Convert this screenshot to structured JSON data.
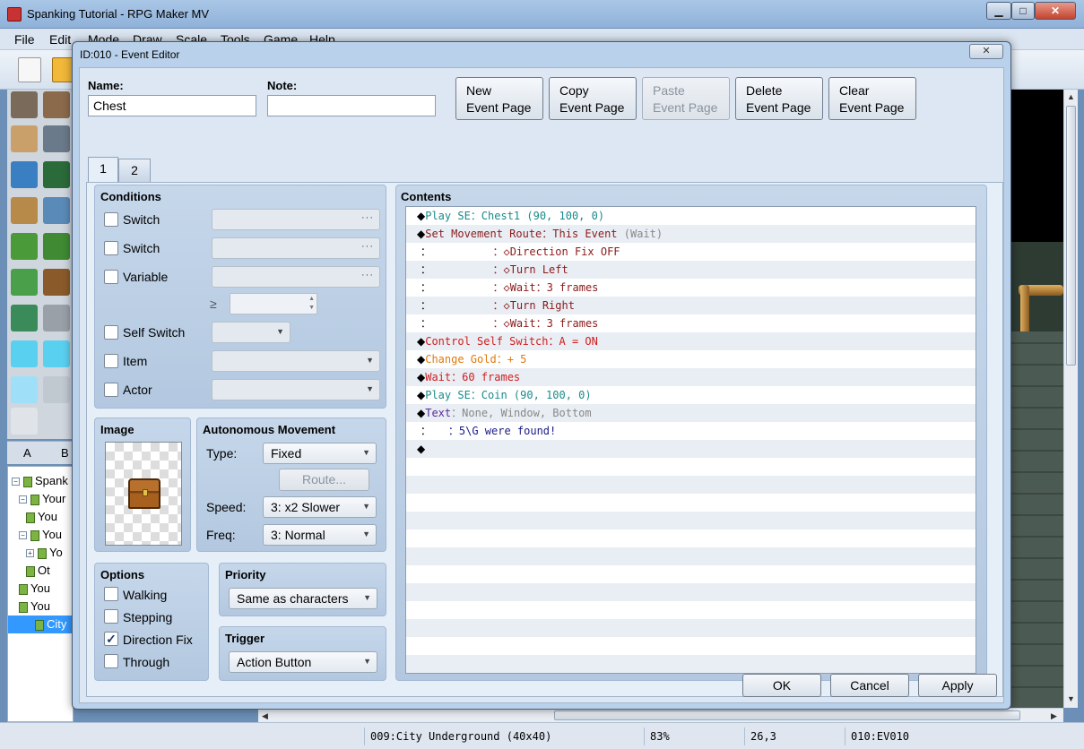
{
  "window": {
    "title": "Spanking Tutorial - RPG Maker MV",
    "controls": [
      "minimize",
      "maximize",
      "close"
    ]
  },
  "menu": [
    "File",
    "Edit",
    "Mode",
    "Draw",
    "Scale",
    "Tools",
    "Game",
    "Help"
  ],
  "tileset_tabs": [
    "A",
    "B"
  ],
  "map_tree": [
    {
      "label": "Spank",
      "expander": "−",
      "level": 0
    },
    {
      "label": "Your",
      "expander": "−",
      "level": 1
    },
    {
      "label": "You",
      "expander": "",
      "level": 2
    },
    {
      "label": "You",
      "expander": "−",
      "level": 1
    },
    {
      "label": "Yo",
      "expander": "+",
      "level": 2
    },
    {
      "label": "Ot",
      "expander": "",
      "level": 2
    },
    {
      "label": "You",
      "expander": "",
      "level": 1
    },
    {
      "label": "You",
      "expander": "",
      "level": 1
    },
    {
      "label": "City",
      "expander": "",
      "level": 1,
      "selected": true
    }
  ],
  "statusbar": {
    "map": "009:City Underground (40x40)",
    "zoom": "83%",
    "coords": "26,3",
    "event": "010:EV010"
  },
  "dialog": {
    "title": "ID:010 - Event Editor",
    "close_label": "✕",
    "name_label": "Name:",
    "name_value": "Chest",
    "note_label": "Note:",
    "note_value": "",
    "page_buttons": {
      "new": [
        "New",
        "Event Page"
      ],
      "copy": [
        "Copy",
        "Event Page"
      ],
      "paste": [
        "Paste",
        "Event Page"
      ],
      "delete": [
        "Delete",
        "Event Page"
      ],
      "clear": [
        "Clear",
        "Event Page"
      ]
    },
    "tabs": [
      "1",
      "2"
    ],
    "active_tab": "1",
    "conditions": {
      "heading": "Conditions",
      "switch1": {
        "label": "Switch",
        "checked": false
      },
      "switch2": {
        "label": "Switch",
        "checked": false
      },
      "variable": {
        "label": "Variable",
        "checked": false
      },
      "ge_symbol": "≥",
      "self_switch": {
        "label": "Self Switch",
        "checked": false
      },
      "item": {
        "label": "Item",
        "checked": false
      },
      "actor": {
        "label": "Actor",
        "checked": false
      }
    },
    "image": {
      "heading": "Image",
      "graphic": "chest"
    },
    "autonomous": {
      "heading": "Autonomous Movement",
      "type_label": "Type:",
      "type_value": "Fixed",
      "route_button": "Route...",
      "speed_label": "Speed:",
      "speed_value": "3: x2 Slower",
      "freq_label": "Freq:",
      "freq_value": "3: Normal"
    },
    "options": {
      "heading": "Options",
      "walking": {
        "label": "Walking",
        "checked": false
      },
      "stepping": {
        "label": "Stepping",
        "checked": false
      },
      "direction_fix": {
        "label": "Direction Fix",
        "checked": true
      },
      "through": {
        "label": "Through",
        "checked": false
      }
    },
    "priority": {
      "heading": "Priority",
      "value": "Same as characters"
    },
    "trigger": {
      "heading": "Trigger",
      "value": "Action Button"
    },
    "contents": {
      "heading": "Contents",
      "lines": [
        {
          "prefix": "◆",
          "indent": "",
          "parts": [
            {
              "t": "Play SE：Chest1 (90, 100, 0)",
              "c": "teal"
            }
          ]
        },
        {
          "prefix": "◆",
          "indent": "",
          "parts": [
            {
              "t": "Set Movement Route：This Event ",
              "c": "maroon"
            },
            {
              "t": "(Wait)",
              "c": "gray"
            }
          ]
        },
        {
          "prefix": " ：",
          "indent": "                  ",
          "parts": [
            {
              "t": "：◇Direction Fix OFF",
              "c": "maroon"
            }
          ]
        },
        {
          "prefix": " ：",
          "indent": "                  ",
          "parts": [
            {
              "t": "：◇Turn Left",
              "c": "maroon"
            }
          ]
        },
        {
          "prefix": " ：",
          "indent": "                  ",
          "parts": [
            {
              "t": "：◇Wait：3 frames",
              "c": "maroon"
            }
          ]
        },
        {
          "prefix": " ：",
          "indent": "                  ",
          "parts": [
            {
              "t": "：◇Turn Right",
              "c": "maroon"
            }
          ]
        },
        {
          "prefix": " ：",
          "indent": "                  ",
          "parts": [
            {
              "t": "：◇Wait：3 frames",
              "c": "maroon"
            }
          ]
        },
        {
          "prefix": "◆",
          "indent": "",
          "parts": [
            {
              "t": "Control Self Switch：A = ON",
              "c": "red"
            }
          ]
        },
        {
          "prefix": "◆",
          "indent": "",
          "parts": [
            {
              "t": "Change Gold：+ 5",
              "c": "orange"
            }
          ]
        },
        {
          "prefix": "◆",
          "indent": "",
          "parts": [
            {
              "t": "Wait：60 frames",
              "c": "red"
            }
          ]
        },
        {
          "prefix": "◆",
          "indent": "",
          "parts": [
            {
              "t": "Play SE：Coin (90, 100, 0)",
              "c": "teal"
            }
          ]
        },
        {
          "prefix": "◆",
          "indent": "",
          "parts": [
            {
              "t": "Text",
              "c": "purple"
            },
            {
              "t": "：None, Window, Bottom",
              "c": "gray"
            }
          ]
        },
        {
          "prefix": " ：",
          "indent": "     ",
          "parts": [
            {
              "t": "：5\\G were found!",
              "c": "navy"
            }
          ]
        },
        {
          "prefix": "◆",
          "indent": "",
          "parts": []
        }
      ]
    },
    "footer": {
      "ok": "OK",
      "cancel": "Cancel",
      "apply": "Apply"
    }
  }
}
